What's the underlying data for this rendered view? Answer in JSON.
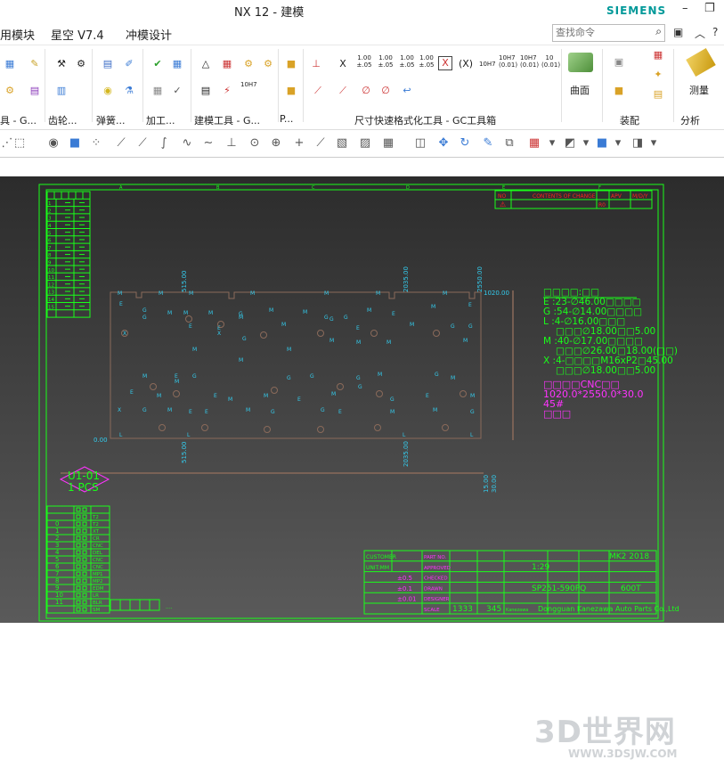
{
  "window": {
    "title": "NX 12 - 建模",
    "brand": "SIEMENS"
  },
  "menu": {
    "items": [
      "用模块",
      "星空 V7.4",
      "冲模设计"
    ],
    "search_placeholder": "查找命令"
  },
  "ribbon": {
    "groups": [
      "具 - G...",
      "齿轮...",
      "弹簧...",
      "加工...",
      "建模工具 - G...",
      "P...",
      "尺寸快速格式化工具 - GC工具箱",
      "装配",
      "分析"
    ],
    "big_buttons": [
      "曲面",
      "测量"
    ],
    "dim_buttons": [
      "X",
      "1.00\n±.05",
      "1.00\n±.05",
      "1.00\n±.05",
      "1.00\n±.05",
      "X",
      "(X)",
      "10H7",
      "10H7\n(0.01)",
      "10H7\n(0.01)",
      "10\n(0.01)"
    ],
    "hole_label": "10H7"
  },
  "drawing": {
    "border_letters": [
      "A",
      "B",
      "C",
      "D",
      "E",
      "F"
    ],
    "revision_header": [
      "NO",
      "CONTENTS OF CHANGE",
      "APV",
      "M/D/Y"
    ],
    "revision_row_1": [
      "R0"
    ],
    "rev_table_rows": [
      "1",
      "2",
      "3",
      "4",
      "5",
      "6",
      "7",
      "8",
      "9",
      "10",
      "11",
      "12",
      "13",
      "14",
      "15"
    ],
    "dims": {
      "left_zero": "0.00",
      "d515": "515.00",
      "d2035": "2035.00",
      "d2550": "2550.00",
      "d1020": "1020.00",
      "d15": "15.00",
      "d30": "30.00"
    },
    "spec_lines": [
      "□□□□:□□",
      "E :23-∅46.00□□□□",
      "G :54-∅14.00□□□□",
      "L :4-∅16.00□□□",
      "□□□∅18.00□□5.00",
      "M :40-∅17.00□□□□",
      "□□□∅26.00□18.00(□□)",
      "X :4-□□□□M16xP2□45.00",
      "□□□∅18.00□□5.00"
    ],
    "spec_magenta": [
      "□□□□CNC□□",
      "1020.0*2550.0*30.0",
      "45#",
      "□□□"
    ],
    "part_tag": [
      "U1-01",
      "1 PCS"
    ],
    "hole_marks": [
      "M",
      "G",
      "E",
      "L",
      "X"
    ],
    "title_block": {
      "labels": [
        "CUSTOMER",
        "UNIT:MM",
        "PART NO.",
        "APPROVED",
        "CHECKED",
        "DRAWN",
        "DESIGNER",
        "SCALE"
      ],
      "tolerances": [
        "±0.5",
        "±0.1",
        "±0.01"
      ],
      "values": [
        "1:29",
        "SP251-590PQ",
        "600T",
        "1333",
        "345",
        "MK2 2018"
      ],
      "company": "Dongguan Kanezawa Auto Parts Co.,Ltd",
      "company_short": "Kanezawa"
    },
    "proc_table_rows": [
      "0",
      "1",
      "2",
      "3",
      "4",
      "5",
      "6",
      "7",
      "8",
      "9",
      "10",
      "11"
    ],
    "proc_table_codes": [
      "T2",
      "T2",
      "XT",
      "CR",
      "CNC",
      "DEL",
      "CNC",
      "CNC",
      "MP1",
      "MP2",
      "EDM",
      "LR",
      "BLR",
      "SM"
    ],
    "bottom_note": "...."
  },
  "watermark": {
    "text": "3D世界网",
    "url": "WWW.3DSJW.COM"
  },
  "colors": {
    "line": "#19ff19",
    "magenta": "#ff33ff",
    "red": "#ff2222",
    "part": "#8a6a5a",
    "cyan": "#33ccee"
  }
}
